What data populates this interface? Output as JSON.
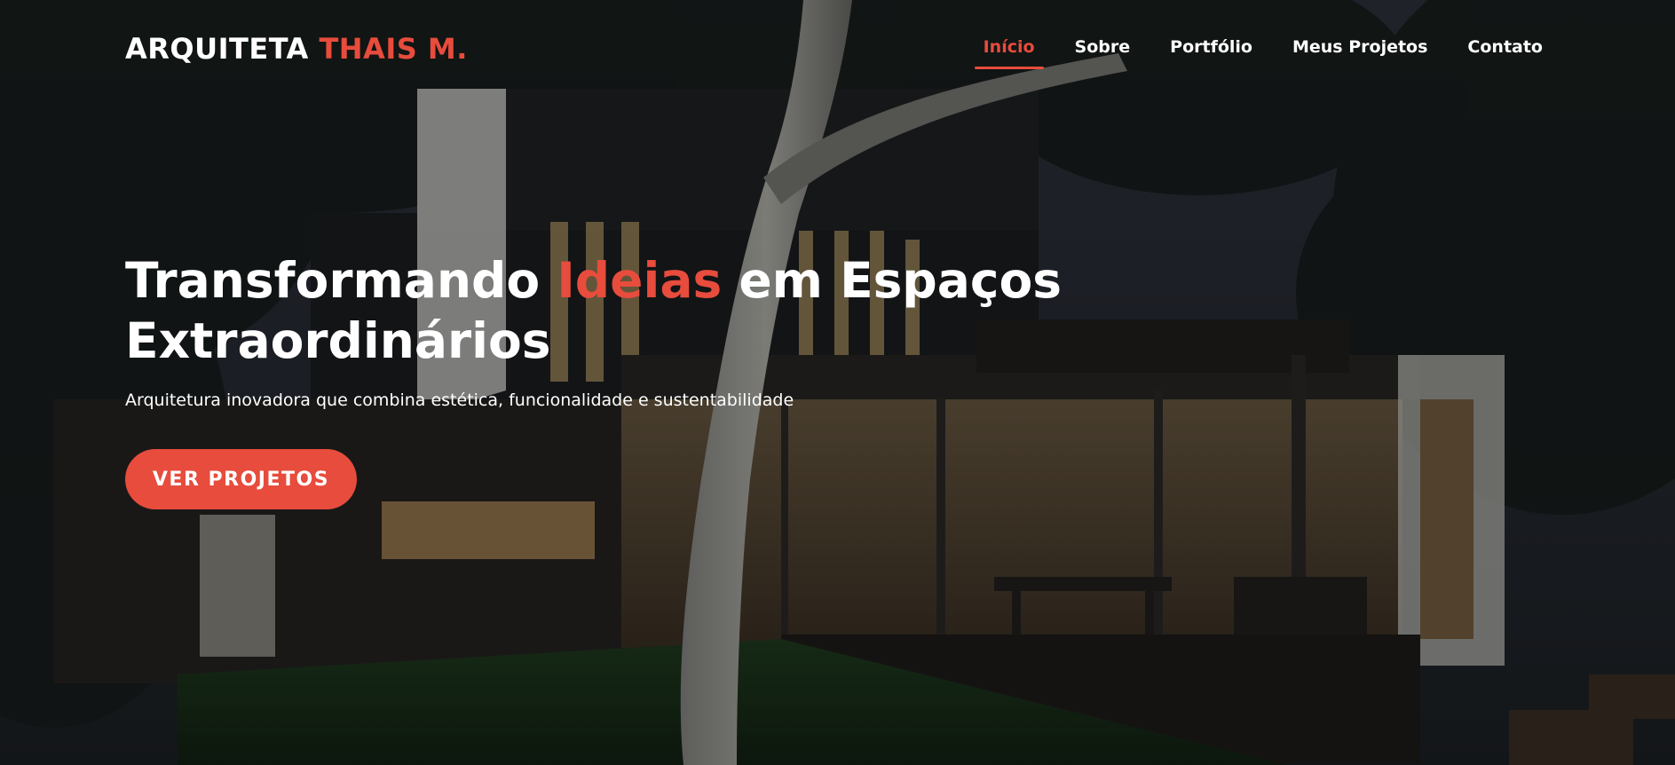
{
  "brand": {
    "name_part1": "ARQUITETA",
    "name_part2": "THAIS M."
  },
  "nav": {
    "items": [
      {
        "label": "Início",
        "active": true
      },
      {
        "label": "Sobre",
        "active": false
      },
      {
        "label": "Portfólio",
        "active": false
      },
      {
        "label": "Meus Projetos",
        "active": false
      },
      {
        "label": "Contato",
        "active": false
      }
    ]
  },
  "hero": {
    "headline_part1": "Transformando",
    "headline_accent": "Ideias",
    "headline_part2": "em Espaços",
    "headline_line2": "Extraordinários",
    "subtitle": "Arquitetura inovadora que combina estética, funcionalidade e sustentabilidade",
    "cta_label": "VER PROJETOS",
    "background_image": "modern-house-at-night"
  },
  "colors": {
    "accent": "#e74c3c",
    "text": "#ffffff",
    "overlay": "#0a0c0e"
  }
}
